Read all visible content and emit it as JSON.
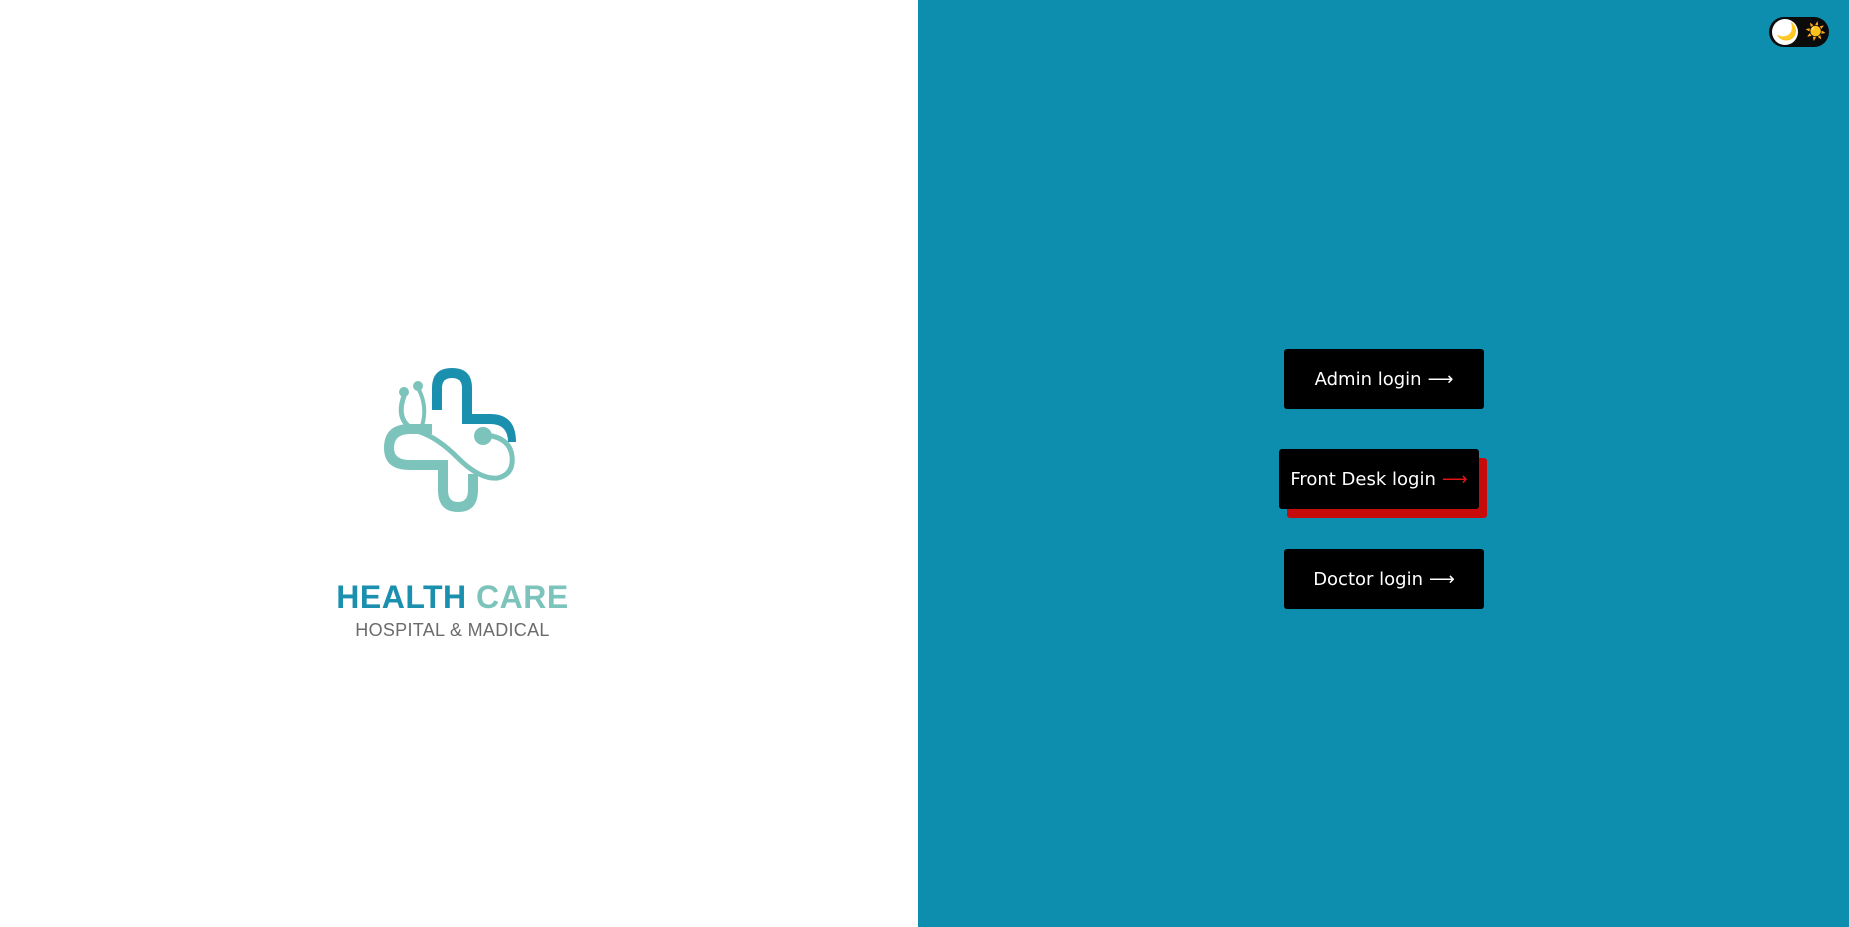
{
  "brand": {
    "title_part1": "HEALTH",
    "title_part2": "CARE",
    "subtitle": "HOSPITAL & MADICAL",
    "logo_icon": "medical-cross-stethoscope-icon",
    "colors": {
      "primary": "#1a8fae",
      "secondary": "#7cc4bb"
    }
  },
  "panel": {
    "background": "#0e8eaf"
  },
  "logins": {
    "admin": {
      "label": "Admin login",
      "arrow": "⟶"
    },
    "frontdesk": {
      "label": "Front Desk login",
      "arrow": "⟶"
    },
    "doctor": {
      "label": "Doctor login",
      "arrow": "⟶"
    }
  },
  "theme_toggle": {
    "moon_icon": "🌙",
    "sun_icon": "☀️",
    "accent_shadow": "#c70a0a"
  }
}
